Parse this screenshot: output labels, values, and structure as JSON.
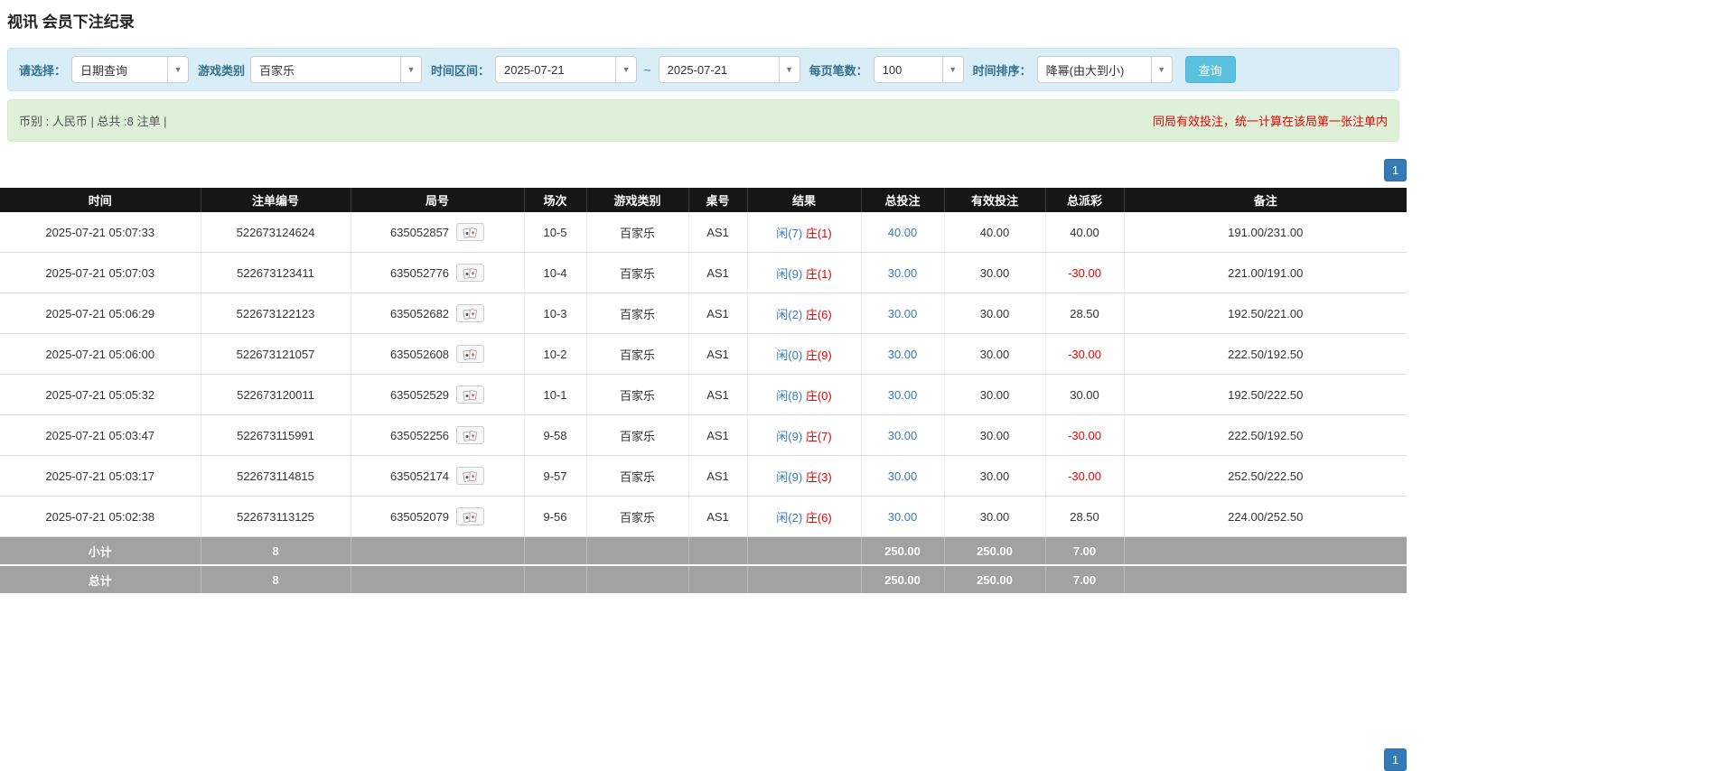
{
  "page": {
    "title": "视讯 会员下注纪录"
  },
  "icons": {
    "caret": "▼"
  },
  "colors": {
    "accent_blue": "#337ab7",
    "negative_red": "#e60000",
    "player_blue": "#337ab7",
    "banker_red": "#e60000",
    "filter_bg": "#d9edf7",
    "summary_bg": "#dff0d8",
    "header_bg": "#161616",
    "footer_bg": "#a2a2a2",
    "search_button_bg": "#5bc0de"
  },
  "filters": {
    "select_label": "请选择：",
    "select_value": "日期查询",
    "game_type_label": "游戏类别",
    "game_type_value": "百家乐",
    "date_range_label": "时间区间：",
    "date_from": "2025-07-21",
    "date_separator": "~",
    "date_to": "2025-07-21",
    "page_size_label": "每页笔数：",
    "page_size_value": "100",
    "sort_label": "时间排序：",
    "sort_value": "降幂(由大到小)",
    "search_button": "查询"
  },
  "summary": {
    "left": "币别 : 人民币 | 总共 :8 注单 |",
    "right": "同局有效投注，统一计算在该局第一张注单内"
  },
  "pagination": {
    "page": "1"
  },
  "table": {
    "headers": [
      "时间",
      "注单编号",
      "局号",
      "场次",
      "游戏类别",
      "桌号",
      "结果",
      "总投注",
      "有效投注",
      "总派彩",
      "备注"
    ],
    "rows": [
      {
        "time": "2025-07-21 05:07:33",
        "bet_id": "522673124624",
        "round": "635052857",
        "session": "10-5",
        "game": "百家乐",
        "table": "AS1",
        "player": "闲(7)",
        "banker": "庄(1)",
        "total_bet": "40.00",
        "valid_bet": "40.00",
        "payout": "40.00",
        "note": "191.00/231.00"
      },
      {
        "time": "2025-07-21 05:07:03",
        "bet_id": "522673123411",
        "round": "635052776",
        "session": "10-4",
        "game": "百家乐",
        "table": "AS1",
        "player": "闲(9)",
        "banker": "庄(1)",
        "total_bet": "30.00",
        "valid_bet": "30.00",
        "payout": "-30.00",
        "note": "221.00/191.00"
      },
      {
        "time": "2025-07-21 05:06:29",
        "bet_id": "522673122123",
        "round": "635052682",
        "session": "10-3",
        "game": "百家乐",
        "table": "AS1",
        "player": "闲(2)",
        "banker": "庄(6)",
        "total_bet": "30.00",
        "valid_bet": "30.00",
        "payout": "28.50",
        "note": "192.50/221.00"
      },
      {
        "time": "2025-07-21 05:06:00",
        "bet_id": "522673121057",
        "round": "635052608",
        "session": "10-2",
        "game": "百家乐",
        "table": "AS1",
        "player": "闲(0)",
        "banker": "庄(9)",
        "total_bet": "30.00",
        "valid_bet": "30.00",
        "payout": "-30.00",
        "note": "222.50/192.50"
      },
      {
        "time": "2025-07-21 05:05:32",
        "bet_id": "522673120011",
        "round": "635052529",
        "session": "10-1",
        "game": "百家乐",
        "table": "AS1",
        "player": "闲(8)",
        "banker": "庄(0)",
        "total_bet": "30.00",
        "valid_bet": "30.00",
        "payout": "30.00",
        "note": "192.50/222.50"
      },
      {
        "time": "2025-07-21 05:03:47",
        "bet_id": "522673115991",
        "round": "635052256",
        "session": "9-58",
        "game": "百家乐",
        "table": "AS1",
        "player": "闲(9)",
        "banker": "庄(7)",
        "total_bet": "30.00",
        "valid_bet": "30.00",
        "payout": "-30.00",
        "note": "222.50/192.50"
      },
      {
        "time": "2025-07-21 05:03:17",
        "bet_id": "522673114815",
        "round": "635052174",
        "session": "9-57",
        "game": "百家乐",
        "table": "AS1",
        "player": "闲(9)",
        "banker": "庄(3)",
        "total_bet": "30.00",
        "valid_bet": "30.00",
        "payout": "-30.00",
        "note": "252.50/222.50"
      },
      {
        "time": "2025-07-21 05:02:38",
        "bet_id": "522673113125",
        "round": "635052079",
        "session": "9-56",
        "game": "百家乐",
        "table": "AS1",
        "player": "闲(2)",
        "banker": "庄(6)",
        "total_bet": "30.00",
        "valid_bet": "30.00",
        "payout": "28.50",
        "note": "224.00/252.50"
      }
    ],
    "subtotal": {
      "label": "小计",
      "count": "8",
      "total_bet": "250.00",
      "valid_bet": "250.00",
      "payout": "7.00"
    },
    "total": {
      "label": "总计",
      "count": "8",
      "total_bet": "250.00",
      "valid_bet": "250.00",
      "payout": "7.00"
    }
  }
}
